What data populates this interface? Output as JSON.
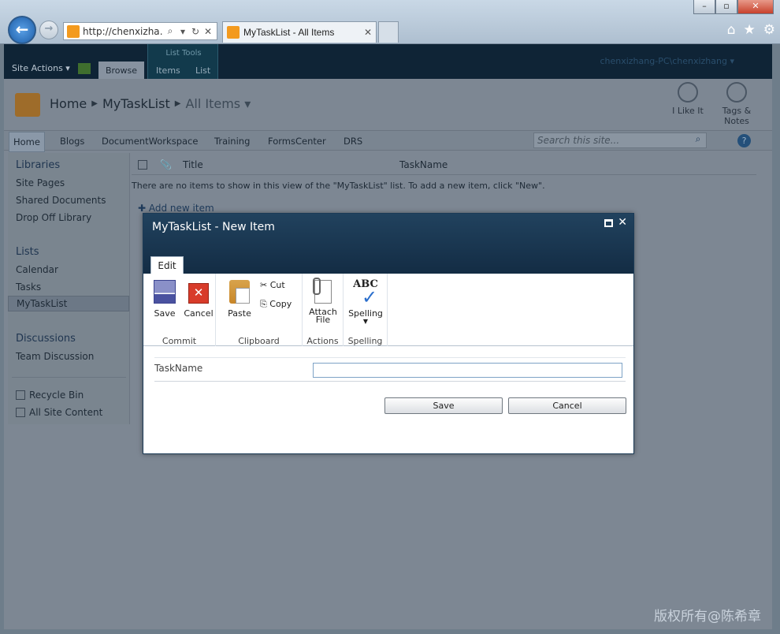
{
  "browser": {
    "address": "http://chenxizha…",
    "tab_title": "MyTaskList - All Items"
  },
  "sp": {
    "site_actions": "Site Actions ▾",
    "tab_browse": "Browse",
    "list_tools": "List Tools",
    "tab_items": "Items",
    "tab_list": "List",
    "user": "chenxizhang-PC\\chenxizhang ▾",
    "breadcrumb": {
      "home": "Home",
      "list": "MyTaskList",
      "view": "All Items ▾"
    },
    "social": {
      "like": "I Like It",
      "tags_l1": "Tags &",
      "tags_l2": "Notes"
    },
    "topnav": [
      "Home",
      "Blogs",
      "DocumentWorkspace",
      "Training",
      "FormsCenter",
      "DRS"
    ],
    "search_placeholder": "Search this site...",
    "quicklaunch": {
      "libraries": "Libraries",
      "lib_items": [
        "Site Pages",
        "Shared Documents",
        "Drop Off Library"
      ],
      "lists": "Lists",
      "list_items": [
        "Calendar",
        "Tasks",
        "MyTaskList"
      ],
      "discussions": "Discussions",
      "disc_items": [
        "Team Discussion"
      ],
      "recycle": "Recycle Bin",
      "all_content": "All Site Content"
    },
    "columns": {
      "title": "Title",
      "taskname": "TaskName"
    },
    "empty_message": "There are no items to show in this view of the \"MyTaskList\" list. To add a new item, click \"New\".",
    "add_new": "Add new item"
  },
  "dialog": {
    "title": "MyTaskList - New Item",
    "tab_edit": "Edit",
    "ribbon": {
      "save": "Save",
      "cancel": "Cancel",
      "commit": "Commit",
      "paste": "Paste",
      "cut": "Cut",
      "copy": "Copy",
      "clipboard": "Clipboard",
      "attach_l1": "Attach",
      "attach_l2": "File",
      "actions": "Actions",
      "spelling_btn": "Spelling",
      "spelling_group": "Spelling"
    },
    "field_label": "TaskName",
    "field_value": "",
    "save_btn": "Save",
    "cancel_btn": "Cancel"
  },
  "watermark": "版权所有@陈希章"
}
